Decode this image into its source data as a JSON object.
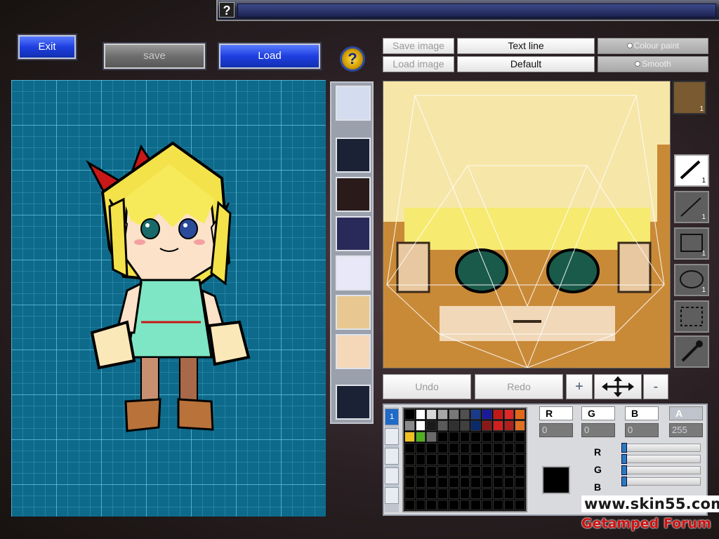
{
  "topbar": {
    "help_label": "?"
  },
  "toolbar": {
    "exit_label": "Exit",
    "save_label": "save",
    "load_label": "Load",
    "help_label": "?"
  },
  "editor": {
    "save_image_label": "Save image",
    "load_image_label": "Load image",
    "text_line_label": "Text line",
    "default_label": "Default",
    "colour_paint_label": "Colour paint",
    "smooth_label": "Smooth",
    "undo_label": "Undo",
    "redo_label": "Redo",
    "zoom_in_label": "+",
    "zoom_out_label": "-"
  },
  "face_thumb": {
    "badge": "1"
  },
  "tools": [
    {
      "name": "pen",
      "count": "1"
    },
    {
      "name": "line",
      "count": "1"
    },
    {
      "name": "rectangle",
      "count": "1"
    },
    {
      "name": "ellipse",
      "count": "1"
    },
    {
      "name": "select",
      "count": ""
    },
    {
      "name": "eyedropper",
      "count": ""
    }
  ],
  "palette": {
    "active_tab": "1",
    "row1": [
      "#000000",
      "#ffffff",
      "#d8d8d8",
      "#a8a8a8",
      "#787878",
      "#505050",
      "#1a3a8a",
      "#1a1a9a",
      "#c01818",
      "#e02828",
      "#e06818",
      "#d8a018"
    ],
    "row2": [
      "#8a8a8a",
      "#ffffff",
      "#1a1a1a",
      "#5a5a5a",
      "#303030",
      "#404040",
      "#0a2a6a",
      "#8a1a1a",
      "#d02020",
      "#b02020",
      "#e07020",
      "#c89020"
    ],
    "row3": [
      "#f0c020",
      "#50b020",
      "#6a6a6a"
    ]
  },
  "channels": {
    "r_label": "R",
    "g_label": "G",
    "b_label": "B",
    "a_label": "A",
    "r_value": "0",
    "g_value": "0",
    "b_value": "0",
    "a_value": "255"
  },
  "current_color": "#000000",
  "watermark": {
    "url": "www.skin55.com",
    "forum": "Getamped Forum"
  }
}
